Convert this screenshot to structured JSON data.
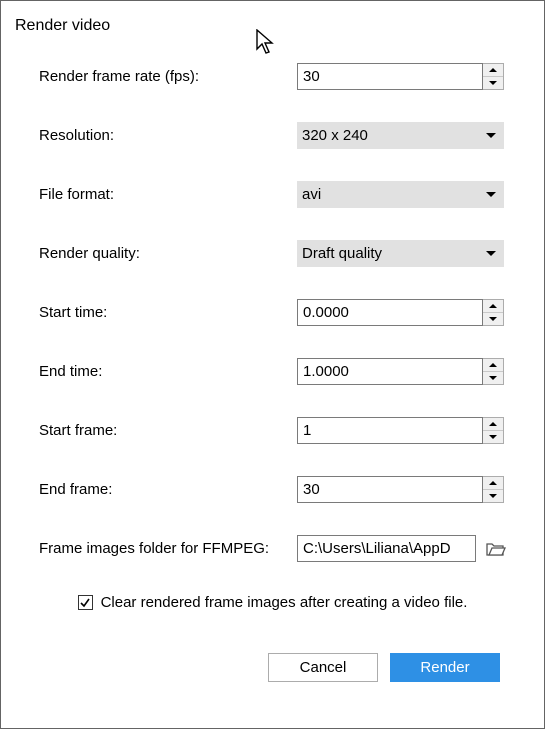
{
  "title": "Render video",
  "labels": {
    "frame_rate": "Render frame rate (fps):",
    "resolution": "Resolution:",
    "file_format": "File format:",
    "render_quality": "Render quality:",
    "start_time": "Start time:",
    "end_time": "End time:",
    "start_frame": "Start frame:",
    "end_frame": "End frame:",
    "ffmpeg_folder": "Frame images folder for FFMPEG:"
  },
  "values": {
    "frame_rate": "30",
    "resolution": "320 x 240",
    "file_format": "avi",
    "render_quality": "Draft quality",
    "start_time": "0.0000",
    "end_time": "1.0000",
    "start_frame": "1",
    "end_frame": "30",
    "ffmpeg_folder": "C:\\Users\\Liliana\\AppD"
  },
  "checkbox": {
    "clear_frames_label": "Clear rendered frame images after creating a video file.",
    "checked": true
  },
  "buttons": {
    "cancel": "Cancel",
    "render": "Render"
  }
}
